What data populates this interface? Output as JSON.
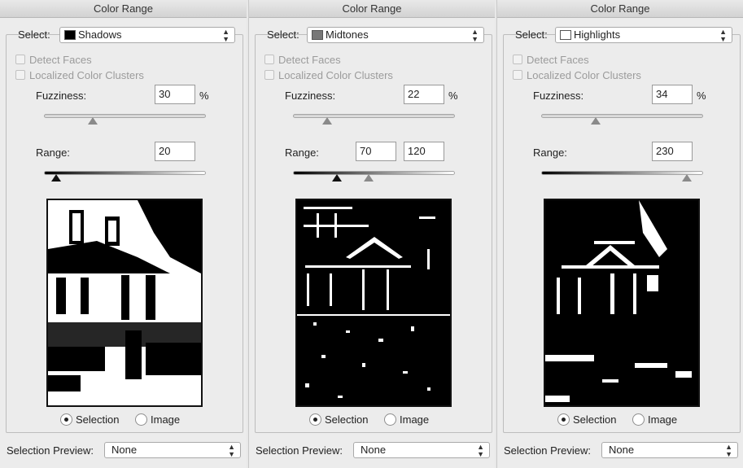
{
  "panels": [
    {
      "title": "Color Range",
      "select_label": "Select:",
      "select_value": "Shadows",
      "swatch_color": "#000000",
      "detect_faces": "Detect Faces",
      "localized_clusters": "Localized Color Clusters",
      "fuzziness_label": "Fuzziness:",
      "fuzziness_value": "30",
      "fuzziness_unit": "%",
      "range_label": "Range:",
      "range_values": [
        "20"
      ],
      "radio_selection": "Selection",
      "radio_image": "Image",
      "preview_label": "Selection Preview:",
      "preview_value": "None"
    },
    {
      "title": "Color Range",
      "select_label": "Select:",
      "select_value": "Midtones",
      "swatch_color": "#777777",
      "detect_faces": "Detect Faces",
      "localized_clusters": "Localized Color Clusters",
      "fuzziness_label": "Fuzziness:",
      "fuzziness_value": "22",
      "fuzziness_unit": "%",
      "range_label": "Range:",
      "range_values": [
        "70",
        "120"
      ],
      "radio_selection": "Selection",
      "radio_image": "Image",
      "preview_label": "Selection Preview:",
      "preview_value": "None"
    },
    {
      "title": "Color Range",
      "select_label": "Select:",
      "select_value": "Highlights",
      "swatch_color": "#ffffff",
      "detect_faces": "Detect Faces",
      "localized_clusters": "Localized Color Clusters",
      "fuzziness_label": "Fuzziness:",
      "fuzziness_value": "34",
      "fuzziness_unit": "%",
      "range_label": "Range:",
      "range_values": [
        "230"
      ],
      "radio_selection": "Selection",
      "radio_image": "Image",
      "preview_label": "Selection Preview:",
      "preview_value": "None"
    }
  ]
}
